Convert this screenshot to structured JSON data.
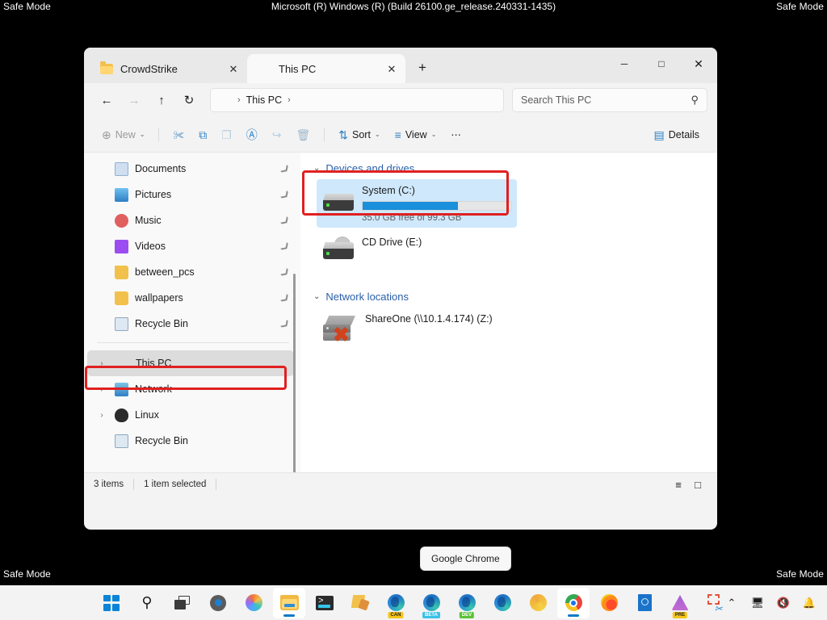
{
  "desktop": {
    "safe_mode_label": "Safe Mode",
    "build_banner": "Microsoft (R) Windows (R) (Build 26100.ge_release.240331-1435)",
    "background_color": "#000000"
  },
  "window": {
    "tabs": [
      {
        "label": "CrowdStrike",
        "icon": "folder-icon",
        "close_label": "✕",
        "active": false
      },
      {
        "label": "This PC",
        "icon": "monitor-icon",
        "close_label": "✕",
        "active": true
      }
    ],
    "new_tab_label": "+",
    "controls": {
      "minimize": "─",
      "maximize": "□",
      "close": "✕"
    }
  },
  "navbar": {
    "back": "←",
    "forward": "→",
    "up": "↑",
    "refresh": "↻",
    "breadcrumb": {
      "root_icon": "monitor-icon",
      "sep": "›",
      "items": [
        "This PC"
      ],
      "trailing_sep": "›"
    },
    "search": {
      "placeholder": "Search This PC",
      "value": "",
      "icon": "search-icon"
    }
  },
  "toolbar": {
    "new_label": "New",
    "new_icon": "⊕",
    "cut_icon": "✀",
    "copy_icon": "⧉",
    "paste_icon": "❐",
    "rename_icon": "Ⓐ",
    "share_icon": "↪",
    "delete_icon": "Ὕ1",
    "sort_label": "Sort",
    "sort_icon": "⇅",
    "view_label": "View",
    "view_icon": "≡",
    "more_label": "⋯",
    "details_label": "Details",
    "details_icon": "▤",
    "chevron": "⌄"
  },
  "sidebar": {
    "quick_access": [
      {
        "label": "Documents",
        "icon": "documents-icon",
        "pinned": true
      },
      {
        "label": "Pictures",
        "icon": "pictures-icon",
        "pinned": true
      },
      {
        "label": "Music",
        "icon": "music-icon",
        "pinned": true
      },
      {
        "label": "Videos",
        "icon": "videos-icon",
        "pinned": true
      },
      {
        "label": "between_pcs",
        "icon": "folder-icon",
        "pinned": true
      },
      {
        "label": "wallpapers",
        "icon": "folder-icon",
        "pinned": true
      },
      {
        "label": "Recycle Bin",
        "icon": "recycle-bin-icon",
        "pinned": true
      }
    ],
    "tree": [
      {
        "label": "This PC",
        "icon": "monitor-icon",
        "expander": "›",
        "selected": true,
        "highlighted": true
      },
      {
        "label": "Network",
        "icon": "network-icon",
        "expander": "›",
        "selected": false,
        "highlighted": false
      },
      {
        "label": "Linux",
        "icon": "linux-icon",
        "expander": "›",
        "selected": false,
        "highlighted": false
      },
      {
        "label": "Recycle Bin",
        "icon": "recycle-bin-icon",
        "expander": "",
        "selected": false,
        "highlighted": false
      }
    ],
    "pin_glyph": "❯"
  },
  "content": {
    "groups": [
      {
        "title": "Devices and drives",
        "chevron": "⌄",
        "items": [
          {
            "name": "System (C:)",
            "icon": "hard-drive-icon",
            "usage_text": "35.0 GB free of 99.3 GB",
            "free_gb": 35.0,
            "total_gb": 99.3,
            "used_percent": 64,
            "bar_color": "#1a8fdb",
            "selected": true,
            "highlighted": true
          },
          {
            "name": "CD Drive (E:)",
            "icon": "cd-drive-icon",
            "usage_text": "",
            "selected": false,
            "highlighted": false
          }
        ]
      },
      {
        "title": "Network locations",
        "chevron": "⌄",
        "items": [
          {
            "name": "ShareOne (\\\\10.1.4.174) (Z:)",
            "icon": "network-drive-disconnected-icon",
            "usage_text": "",
            "selected": false,
            "highlighted": false
          }
        ]
      }
    ]
  },
  "statusbar": {
    "item_count": "3 items",
    "selection": "1 item selected",
    "list_view_icon": "≡",
    "details_view_icon": "□"
  },
  "tooltip": {
    "text": "Google Chrome"
  },
  "taskbar": {
    "items": [
      {
        "name": "start-button",
        "glyph": "start-icon",
        "active": false,
        "badge": ""
      },
      {
        "name": "search-button",
        "glyph": "search-icon",
        "active": false,
        "badge": ""
      },
      {
        "name": "task-view-button",
        "glyph": "task-view-icon",
        "active": false,
        "badge": ""
      },
      {
        "name": "settings-button",
        "glyph": "gear-icon",
        "active": false,
        "badge": ""
      },
      {
        "name": "copilot-button",
        "glyph": "copilot-icon",
        "active": false,
        "badge": ""
      },
      {
        "name": "file-explorer-button",
        "glyph": "file-explorer-icon",
        "active": true,
        "badge": ""
      },
      {
        "name": "terminal-button",
        "glyph": "terminal-icon",
        "active": false,
        "badge": ""
      },
      {
        "name": "notepadpp-button",
        "glyph": "notepad-wrench-icon",
        "active": false,
        "badge": ""
      },
      {
        "name": "edge-canary-button",
        "glyph": "edge-icon",
        "active": false,
        "badge": "CAN"
      },
      {
        "name": "edge-beta-button",
        "glyph": "edge-icon",
        "active": false,
        "badge": "BETA"
      },
      {
        "name": "edge-dev-button",
        "glyph": "edge-icon",
        "active": false,
        "badge": "DEV"
      },
      {
        "name": "edge-button",
        "glyph": "edge-icon",
        "active": false,
        "badge": ""
      },
      {
        "name": "chrome-canary-button",
        "glyph": "chrome-canary-icon",
        "active": false,
        "badge": ""
      },
      {
        "name": "google-chrome-button",
        "glyph": "chrome-icon",
        "active": true,
        "badge": ""
      },
      {
        "name": "firefox-button",
        "glyph": "firefox-icon",
        "active": false,
        "badge": ""
      },
      {
        "name": "docs-button",
        "glyph": "docs-icon",
        "active": false,
        "badge": ""
      },
      {
        "name": "premiere-button",
        "glyph": "premiere-icon",
        "active": false,
        "badge": "PRE"
      },
      {
        "name": "snipping-tool-button",
        "glyph": "snip-icon",
        "active": false,
        "badge": ""
      }
    ],
    "tray": [
      {
        "name": "show-hidden-icons",
        "glyph": "⌃"
      },
      {
        "name": "network-icon",
        "glyph": "⬚"
      },
      {
        "name": "volume-muted-icon",
        "glyph": "⌗"
      },
      {
        "name": "notifications-icon",
        "glyph": "⌕"
      }
    ]
  }
}
